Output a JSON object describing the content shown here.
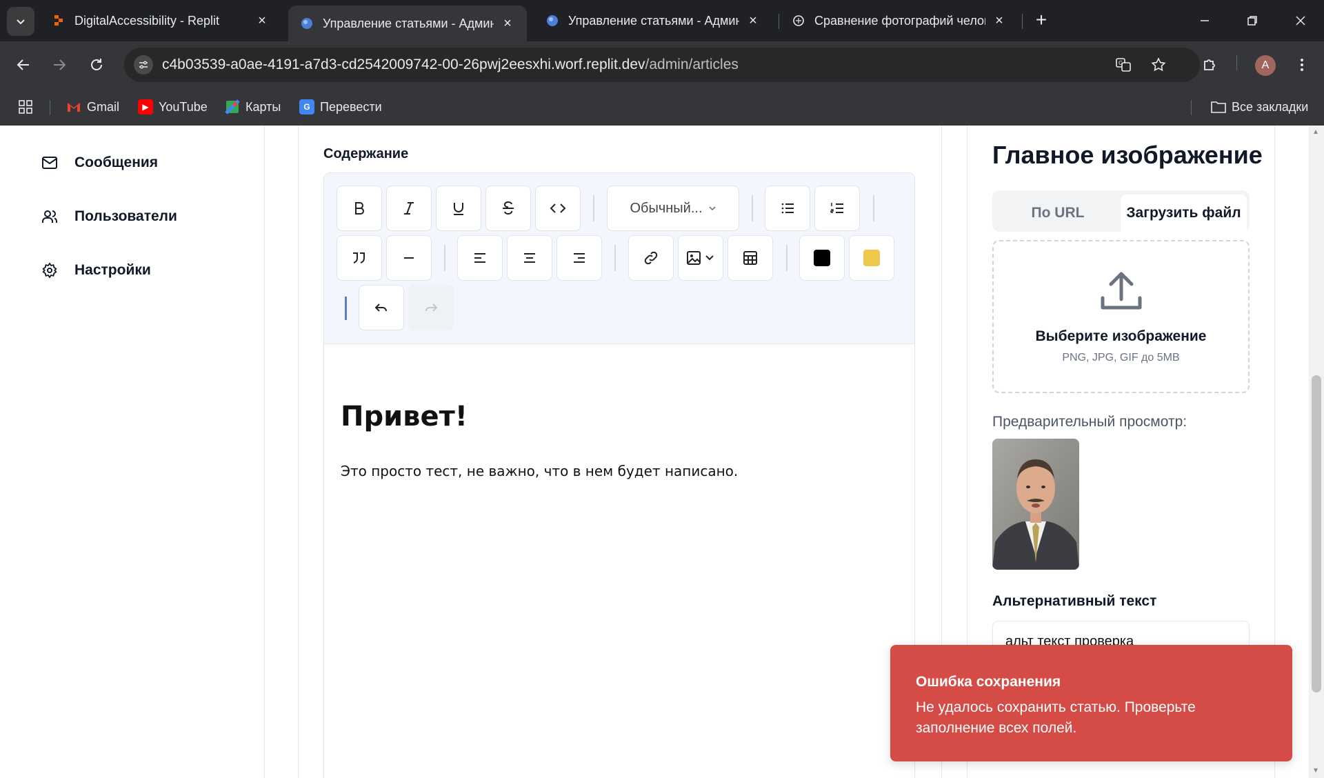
{
  "browser": {
    "tabs": [
      {
        "title": "DigitalAccessibility - Replit",
        "active": false
      },
      {
        "title": "Управление статьями - Админ",
        "active": true
      },
      {
        "title": "Управление статьями - Админ",
        "active": false
      },
      {
        "title": "Сравнение фотографий челов",
        "active": false
      }
    ],
    "url_host": "c4b03539-a0ae-4191-a7d3-cd2542009742-00-26pwj2eesxhi.worf.replit.dev",
    "url_path": "/admin/articles",
    "avatar_letter": "A",
    "bookmarks": [
      "Gmail",
      "YouTube",
      "Карты",
      "Перевести"
    ],
    "all_bookmarks": "Все закладки"
  },
  "sidebar": {
    "items": [
      {
        "label": "Сообщения",
        "icon": "mail-icon"
      },
      {
        "label": "Пользователи",
        "icon": "users-icon"
      },
      {
        "label": "Настройки",
        "icon": "settings-icon"
      }
    ]
  },
  "editor": {
    "label": "Содержание",
    "block_format": "Обычный...",
    "heading": "Привет!",
    "paragraph": "Это просто тест, не важно, что в нем будет написано.",
    "text_color": "#000000",
    "highlight_color": "#ecc94b"
  },
  "image_panel": {
    "title": "Главное изображение",
    "tab_url": "По URL",
    "tab_upload": "Загрузить файл",
    "upload_title": "Выберите изображение",
    "upload_hint": "PNG, JPG, GIF до 5MB",
    "preview_label": "Предварительный просмотр:",
    "alt_label": "Альтернативный текст",
    "alt_value": "альт текст проверка"
  },
  "toast": {
    "title": "Ошибка сохранения",
    "message": "Не удалось сохранить статью. Проверьте заполнение всех полей."
  },
  "colors": {
    "toast_bg": "#d54b45",
    "toolbar_bg": "#f3f6fc"
  }
}
